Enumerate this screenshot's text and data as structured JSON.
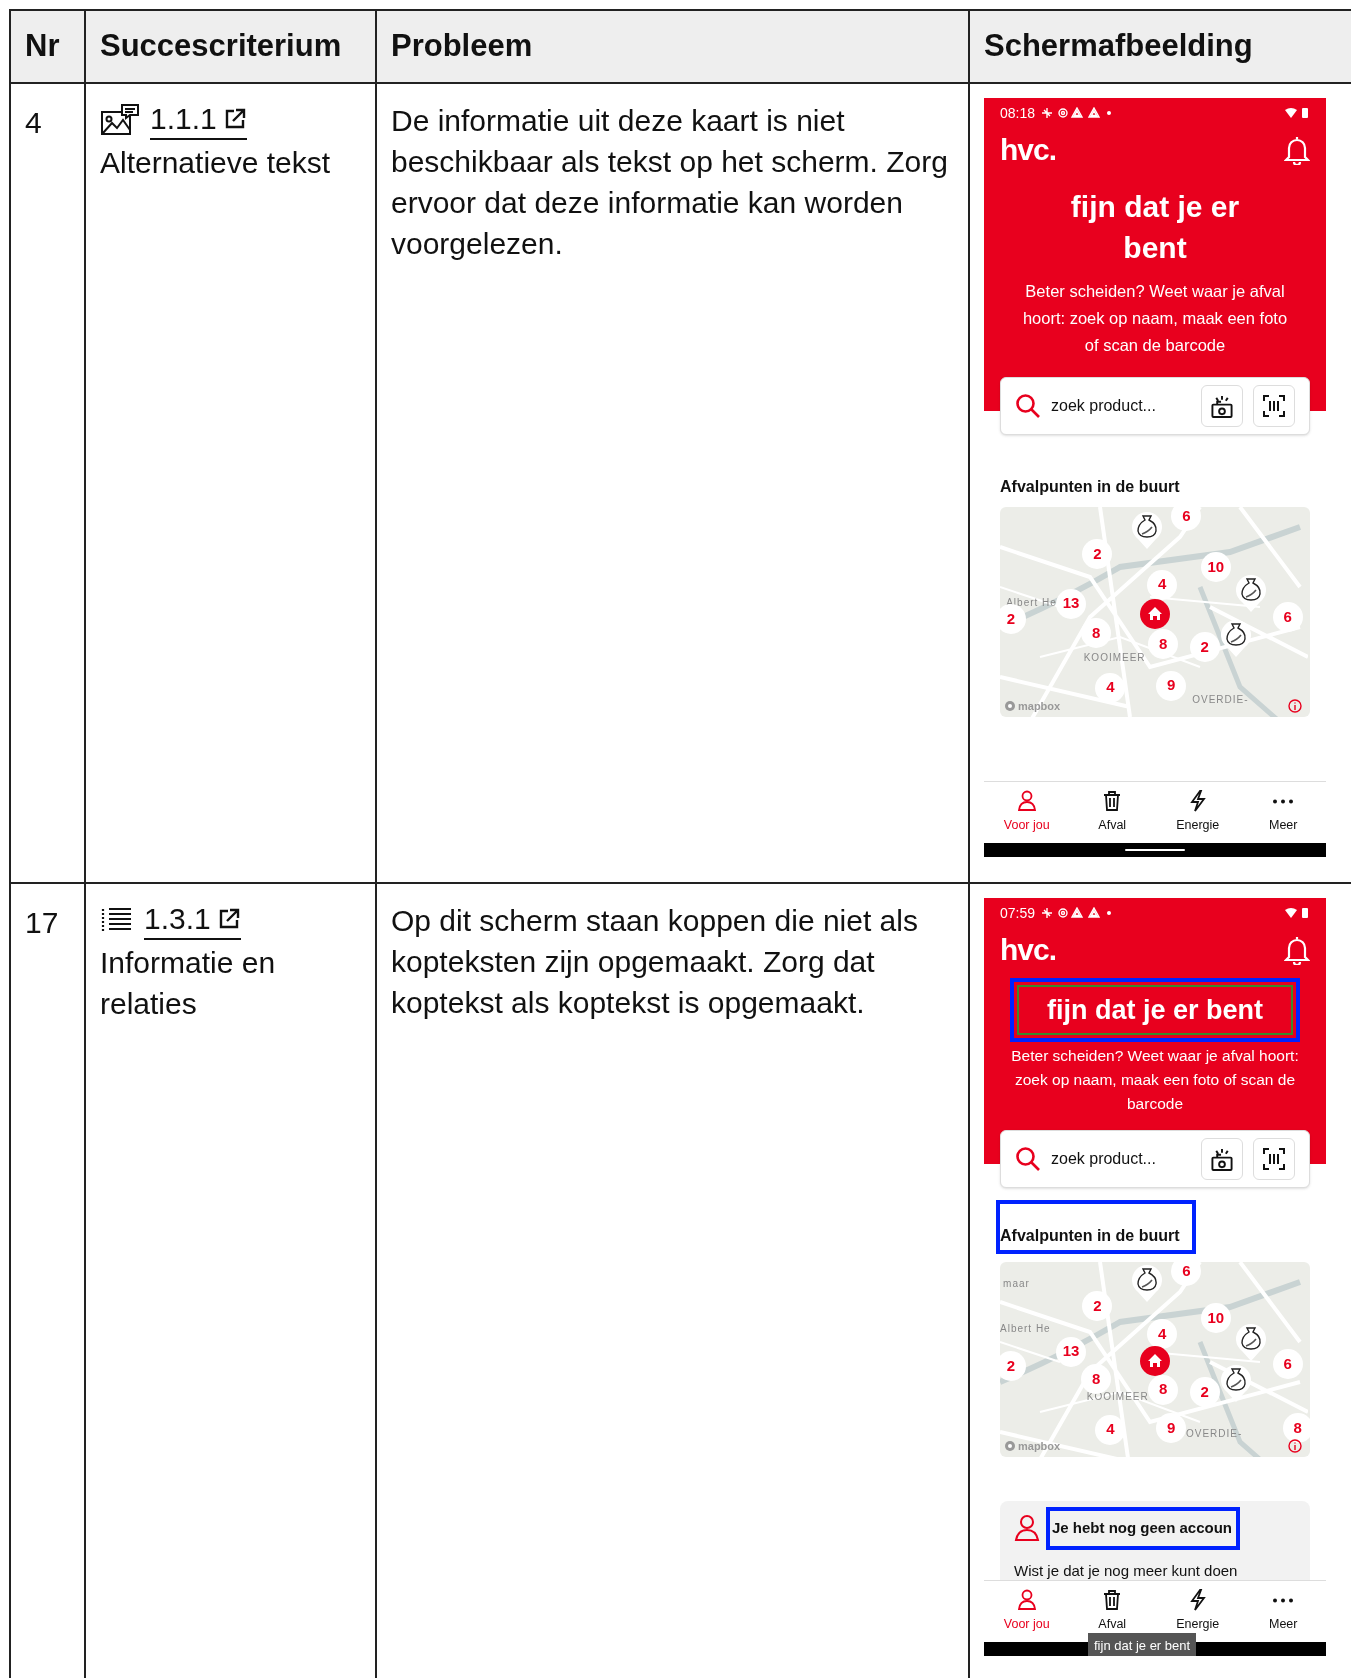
{
  "table": {
    "columns": [
      "Nr",
      "Succescriterium",
      "Probleem",
      "Schermafbeelding"
    ],
    "rows": [
      {
        "nr": "4",
        "criterion": {
          "code": "1.1.1",
          "name": "Alternatieve tekst"
        },
        "problem": "De informatie uit deze kaart is niet beschikbaar als tekst op het scherm. Zorg ervoor dat deze informatie kan worden voorgelezen.",
        "screenshot": {
          "time": "08:18",
          "logo": "hvc.",
          "title": {
            "text": "fijn dat je er bent",
            "highlighted": false
          },
          "intro": "Beter scheiden? Weet waar je afval hoort: zoek op naam, maak een foto of scan de barcode",
          "search": {
            "placeholder": "zoek product..."
          },
          "section": {
            "text": "Afvalpunten in de buurt",
            "highlighted": false
          },
          "map": {
            "labels": [
              "Albert He",
              "KOOIMEER",
              "OVERDIE-"
            ],
            "attribution": "mapbox",
            "markers": [
              {
                "kind": "bag"
              },
              {
                "kind": "number",
                "label": "6"
              },
              {
                "kind": "number",
                "label": "2"
              },
              {
                "kind": "number",
                "label": "10"
              },
              {
                "kind": "bag"
              },
              {
                "kind": "number",
                "label": "4"
              },
              {
                "kind": "home"
              },
              {
                "kind": "number",
                "label": "13"
              },
              {
                "kind": "number",
                "label": "2"
              },
              {
                "kind": "number",
                "label": "6"
              },
              {
                "kind": "number",
                "label": "8"
              },
              {
                "kind": "number",
                "label": "8"
              },
              {
                "kind": "number",
                "label": "2"
              },
              {
                "kind": "bag"
              },
              {
                "kind": "number",
                "label": "4"
              },
              {
                "kind": "number",
                "label": "9"
              }
            ]
          },
          "nav": [
            {
              "label": "Voor jou",
              "selected": true
            },
            {
              "label": "Afval",
              "selected": false
            },
            {
              "label": "Energie",
              "selected": false
            },
            {
              "label": "Meer",
              "selected": false
            }
          ]
        }
      },
      {
        "nr": "17",
        "criterion": {
          "code": "1.3.1",
          "name": "Informatie en relaties"
        },
        "problem": "Op dit scherm staan koppen die niet als kopteksten zijn opgemaakt. Zorg dat koptekst als koptekst is opgemaakt.",
        "screenshot": {
          "time": "07:59",
          "logo": "hvc.",
          "title": {
            "text": "fijn dat je er bent",
            "highlighted": true
          },
          "intro": "Beter scheiden? Weet waar je afval hoort: zoek op naam, maak een foto of scan de barcode",
          "search": {
            "placeholder": "zoek product..."
          },
          "section": {
            "text": "Afvalpunten in de buurt",
            "highlighted": true
          },
          "map": {
            "labels": [
              "maar",
              "Albert He",
              "KOOIMEER",
              "OVERDIE-"
            ],
            "attribution": "mapbox",
            "markers": [
              {
                "kind": "bag"
              },
              {
                "kind": "number",
                "label": "6"
              },
              {
                "kind": "number",
                "label": "2"
              },
              {
                "kind": "number",
                "label": "10"
              },
              {
                "kind": "bag"
              },
              {
                "kind": "number",
                "label": "4"
              },
              {
                "kind": "home"
              },
              {
                "kind": "number",
                "label": "13"
              },
              {
                "kind": "number",
                "label": "2"
              },
              {
                "kind": "number",
                "label": "6"
              },
              {
                "kind": "number",
                "label": "8"
              },
              {
                "kind": "number",
                "label": "8"
              },
              {
                "kind": "number",
                "label": "2"
              },
              {
                "kind": "bag"
              },
              {
                "kind": "number",
                "label": "4"
              },
              {
                "kind": "number",
                "label": "9"
              },
              {
                "kind": "number",
                "label": "8"
              }
            ]
          },
          "card": {
            "title": {
              "text": "Je hebt nog geen accoun",
              "highlighted": true
            },
            "body": "Wist je dat je nog meer kunt doen"
          },
          "nav": [
            {
              "label": "Voor jou",
              "selected": true
            },
            {
              "label": "Afval",
              "selected": false
            },
            {
              "label": "Energie",
              "selected": false
            },
            {
              "label": "Meer",
              "selected": false
            }
          ],
          "toast": {
            "text": "fijn dat je er bent"
          }
        }
      }
    ]
  }
}
